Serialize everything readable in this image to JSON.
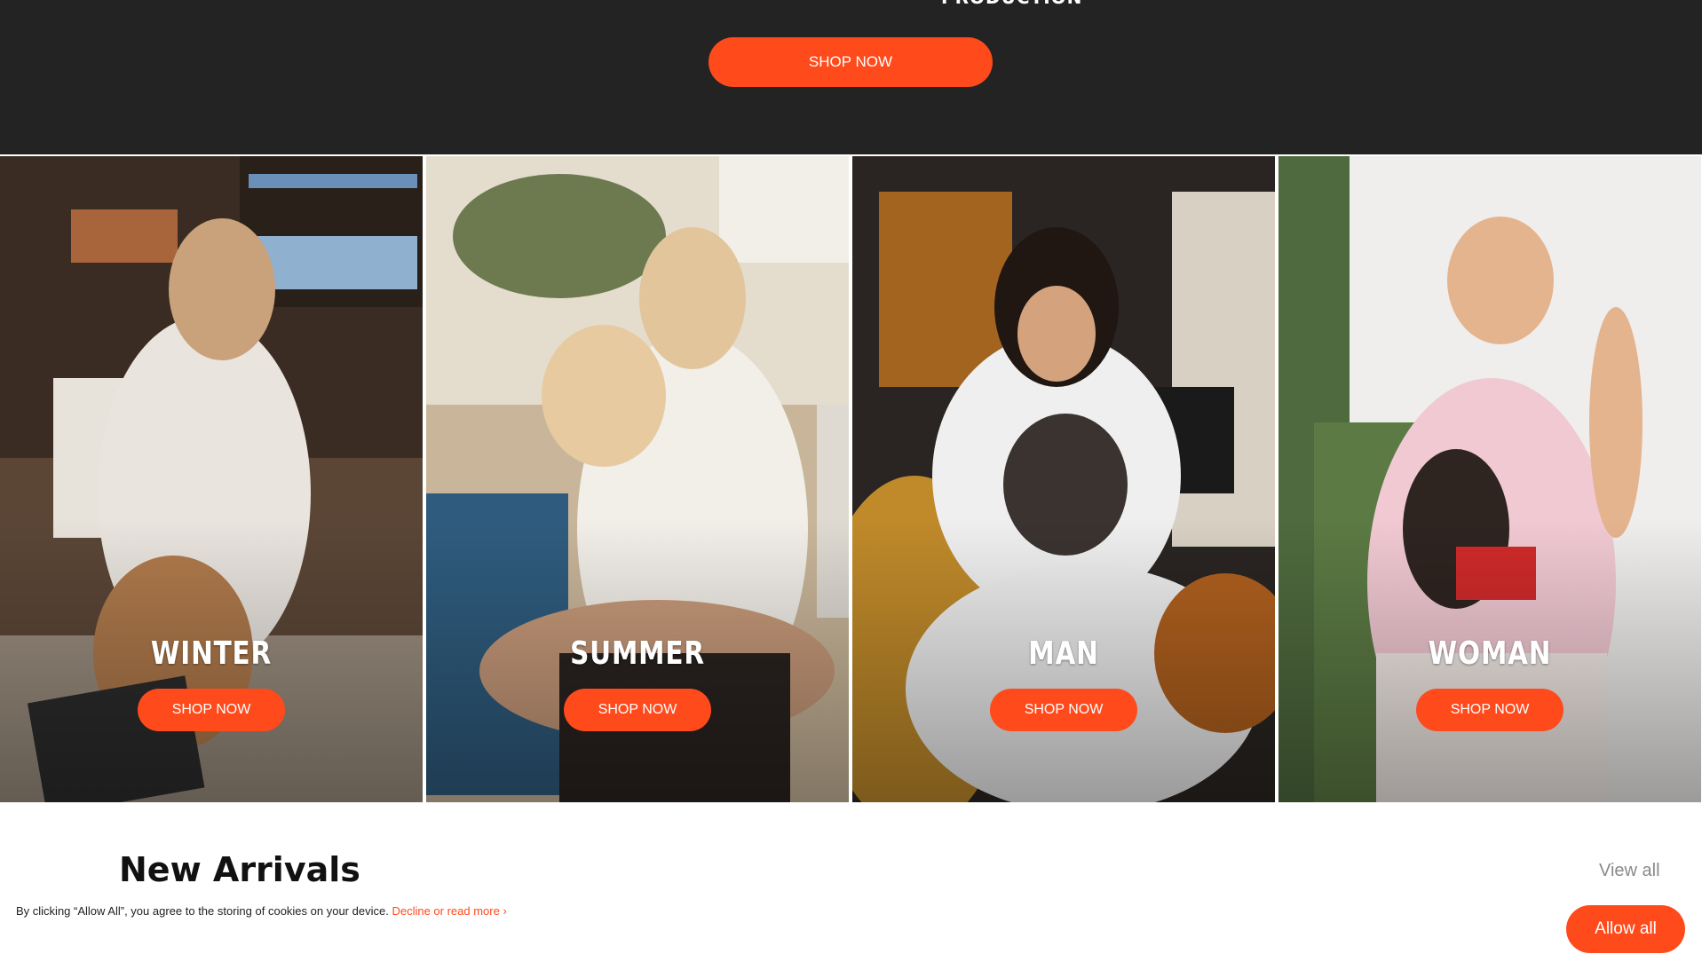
{
  "hero": {
    "partial_heading": "PRODUCTION",
    "shop_now_label": "SHOP NOW"
  },
  "categories": [
    {
      "label": "WINTER",
      "button": "SHOP NOW"
    },
    {
      "label": "SUMMER",
      "button": "SHOP NOW"
    },
    {
      "label": "MAN",
      "button": "SHOP NOW"
    },
    {
      "label": "WOMAN",
      "button": "SHOP NOW"
    }
  ],
  "new_arrivals": {
    "title": "New Arrivals",
    "view_all": "View all"
  },
  "cookie_bar": {
    "text": "By clicking “Allow All”, you agree to the storing of cookies on your device.",
    "link": "Decline or read more ›",
    "allow_label": "Allow all"
  },
  "colors": {
    "accent": "#ff4a1c",
    "hero_bg": "#232323"
  }
}
